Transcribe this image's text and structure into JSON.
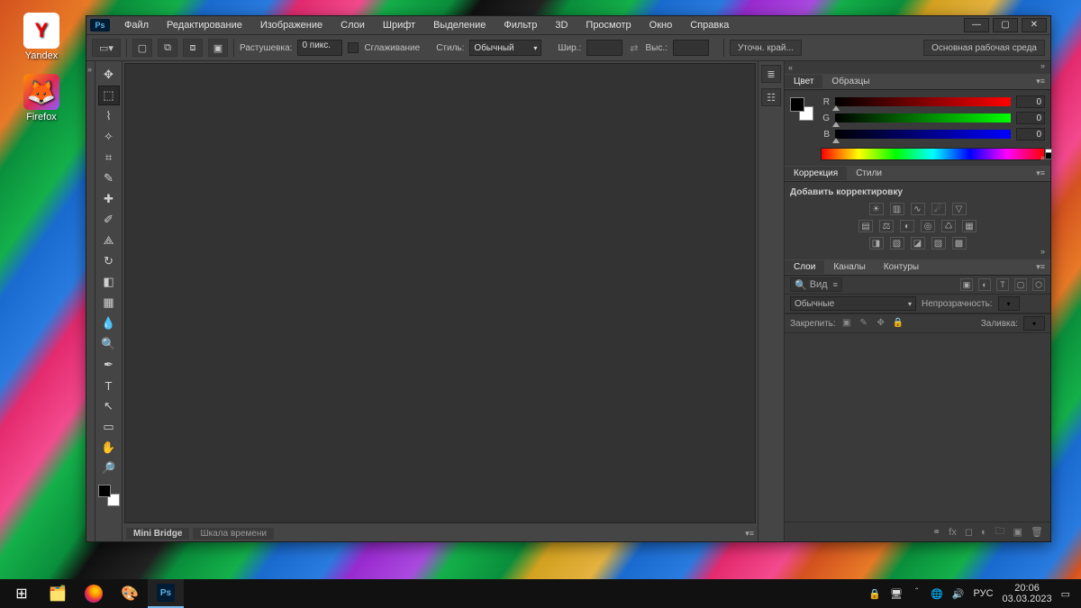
{
  "desktop": {
    "icons": [
      {
        "name": "Yandex"
      },
      {
        "name": "Firefox"
      }
    ]
  },
  "app": {
    "logo": "Ps",
    "menus": [
      "Файл",
      "Редактирование",
      "Изображение",
      "Слои",
      "Шрифт",
      "Выделение",
      "Фильтр",
      "3D",
      "Просмотр",
      "Окно",
      "Справка"
    ],
    "workspace_button": "Основная рабочая среда"
  },
  "options": {
    "feather_label": "Растушевка:",
    "feather_value": "0 пикс.",
    "antialias_label": "Сглаживание",
    "style_label": "Стиль:",
    "style_value": "Обычный",
    "width_label": "Шир.:",
    "width_value": "",
    "height_label": "Выс.:",
    "height_value": "",
    "refine_label": "Уточн. край..."
  },
  "bottom_tabs": {
    "bridge": "Mini Bridge",
    "timeline": "Шкала времени"
  },
  "panels": {
    "color": {
      "tab1": "Цвет",
      "tab2": "Образцы",
      "r": "R",
      "g": "G",
      "b": "B",
      "r_val": "0",
      "g_val": "0",
      "b_val": "0"
    },
    "adjust": {
      "tab1": "Коррекция",
      "tab2": "Стили",
      "title": "Добавить корректировку"
    },
    "layers": {
      "tab1": "Слои",
      "tab2": "Каналы",
      "tab3": "Контуры",
      "kind_label": "Вид",
      "blend_value": "Обычные",
      "opacity_label": "Непрозрачность:",
      "lock_label": "Закрепить:",
      "fill_label": "Заливка:"
    }
  },
  "taskbar": {
    "lang": "РУС",
    "time": "20:06",
    "date": "03.03.2023"
  }
}
